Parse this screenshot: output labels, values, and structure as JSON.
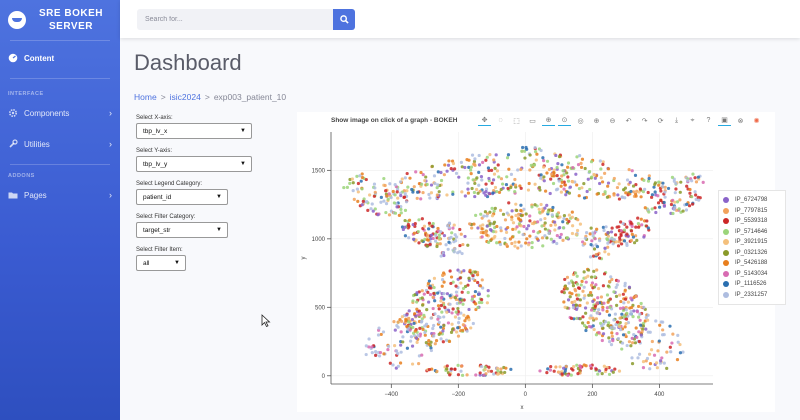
{
  "brand": {
    "line1": "SRE BOKEH",
    "line2": "SERVER"
  },
  "sidebar": {
    "content": "Content",
    "interface_heading": "INTERFACE",
    "components": "Components",
    "utilities": "Utilities",
    "addons_heading": "ADDONS",
    "pages": "Pages"
  },
  "search": {
    "placeholder": "Search for..."
  },
  "page_title": "Dashboard",
  "breadcrumb": {
    "home": "Home",
    "sep": ">",
    "project": "isic2024",
    "current": "exp003_patient_10"
  },
  "controls": {
    "x_axis": {
      "label": "Select X-axis:",
      "value": "tbp_lv_x"
    },
    "y_axis": {
      "label": "Select Y-axis:",
      "value": "tbp_lv_y"
    },
    "legend": {
      "label": "Select Legend Category:",
      "value": "patient_id"
    },
    "filter": {
      "label": "Select Filter Category:",
      "value": "target_str"
    },
    "filter_item": {
      "label": "Select Filter Item:",
      "value": "all"
    }
  },
  "plot": {
    "title": "Show image on click of a graph - BOKEH"
  },
  "chart_data": {
    "type": "scatter",
    "title": "Show image on click of a graph - BOKEH",
    "xlabel": "x",
    "ylabel": "y",
    "xlim": [
      -580,
      560
    ],
    "ylim": [
      -60,
      1780
    ],
    "xticks": [
      -400,
      -200,
      0,
      200,
      400
    ],
    "yticks": [
      0,
      500,
      1000,
      1500
    ],
    "grid": true,
    "legend_position": "right",
    "series": [
      {
        "name": "IP_6724798",
        "color": "#8a63c9"
      },
      {
        "name": "IP_7797815",
        "color": "#f2a25c"
      },
      {
        "name": "IP_5539318",
        "color": "#cc2727"
      },
      {
        "name": "IP_5714646",
        "color": "#9bd57a"
      },
      {
        "name": "IP_3921915",
        "color": "#f4c07c"
      },
      {
        "name": "IP_0321326",
        "color": "#8a9a2a"
      },
      {
        "name": "IP_5426188",
        "color": "#e87f1e"
      },
      {
        "name": "IP_5143034",
        "color": "#d86bb2"
      },
      {
        "name": "IP_1116526",
        "color": "#2a6fb0"
      },
      {
        "name": "IP_2331257",
        "color": "#aebde0"
      }
    ]
  }
}
